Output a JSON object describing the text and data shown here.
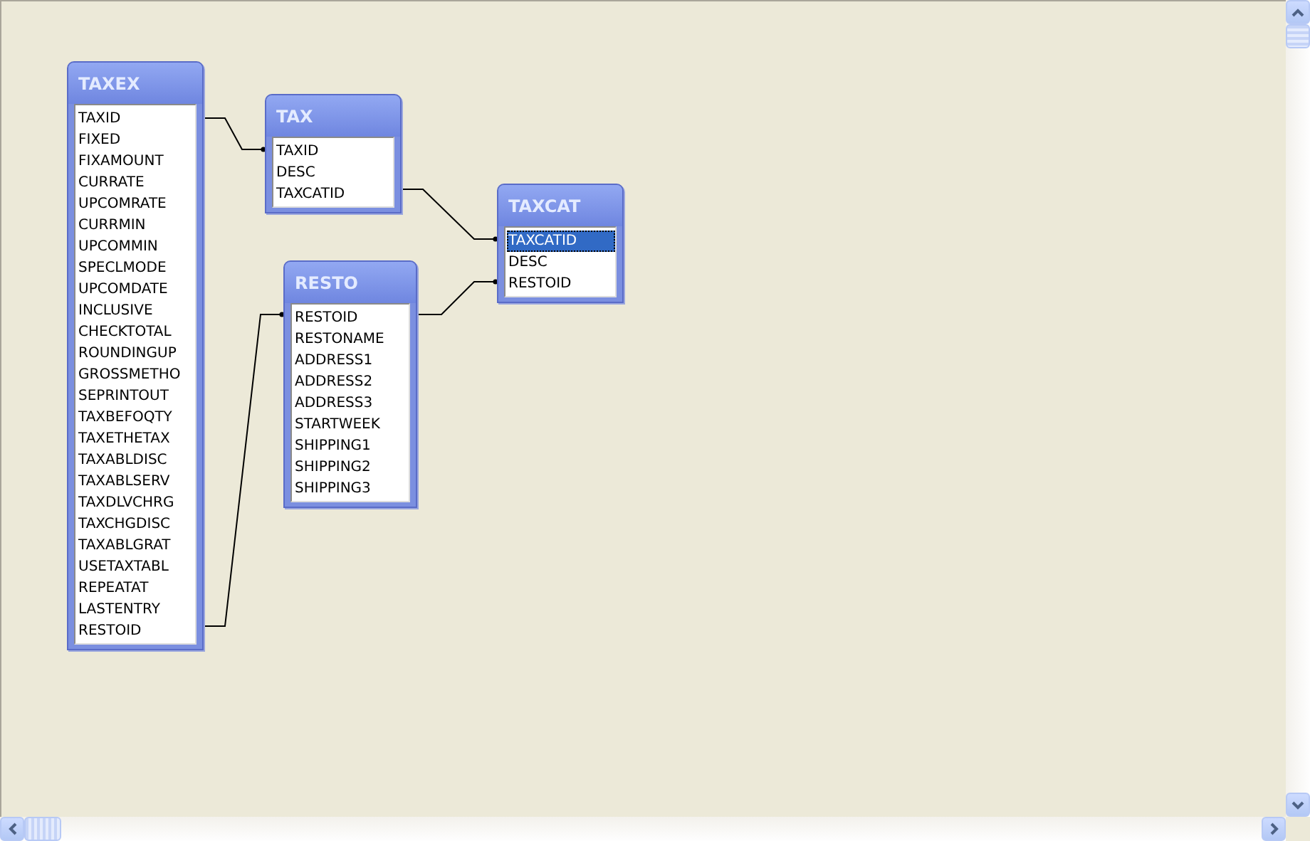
{
  "tables": [
    {
      "name": "TAXEX",
      "fields": [
        {
          "name": "TAXID",
          "selected": false
        },
        {
          "name": "FIXED",
          "selected": false
        },
        {
          "name": "FIXAMOUNT",
          "selected": false
        },
        {
          "name": "CURRATE",
          "selected": false
        },
        {
          "name": "UPCOMRATE",
          "selected": false
        },
        {
          "name": "CURRMIN",
          "selected": false
        },
        {
          "name": "UPCOMMIN",
          "selected": false
        },
        {
          "name": "SPECLMODE",
          "selected": false
        },
        {
          "name": "UPCOMDATE",
          "selected": false
        },
        {
          "name": "INCLUSIVE",
          "selected": false
        },
        {
          "name": "CHECKTOTAL",
          "selected": false
        },
        {
          "name": "ROUNDINGUP",
          "selected": false
        },
        {
          "name": "GROSSMETHO",
          "selected": false
        },
        {
          "name": "SEPRINTOUT",
          "selected": false
        },
        {
          "name": "TAXBEFOQTY",
          "selected": false
        },
        {
          "name": "TAXETHETAX",
          "selected": false
        },
        {
          "name": "TAXABLDISC",
          "selected": false
        },
        {
          "name": "TAXABLSERV",
          "selected": false
        },
        {
          "name": "TAXDLVCHRG",
          "selected": false
        },
        {
          "name": "TAXCHGDISC",
          "selected": false
        },
        {
          "name": "TAXABLGRAT",
          "selected": false
        },
        {
          "name": "USETAXTABL",
          "selected": false
        },
        {
          "name": "REPEATAT",
          "selected": false
        },
        {
          "name": "LASTENTRY",
          "selected": false
        },
        {
          "name": "RESTOID",
          "selected": false
        }
      ]
    },
    {
      "name": "TAX",
      "fields": [
        {
          "name": "TAXID",
          "selected": false
        },
        {
          "name": "DESC",
          "selected": false
        },
        {
          "name": "TAXCATID",
          "selected": false
        }
      ]
    },
    {
      "name": "TAXCAT",
      "fields": [
        {
          "name": "TAXCATID",
          "selected": true
        },
        {
          "name": "DESC",
          "selected": false
        },
        {
          "name": "RESTOID",
          "selected": false
        }
      ]
    },
    {
      "name": "RESTO",
      "fields": [
        {
          "name": "RESTOID",
          "selected": false
        },
        {
          "name": "RESTONAME",
          "selected": false
        },
        {
          "name": "ADDRESS1",
          "selected": false
        },
        {
          "name": "ADDRESS2",
          "selected": false
        },
        {
          "name": "ADDRESS3",
          "selected": false
        },
        {
          "name": "STARTWEEK",
          "selected": false
        },
        {
          "name": "SHIPPING1",
          "selected": false
        },
        {
          "name": "SHIPPING2",
          "selected": false
        },
        {
          "name": "SHIPPING3",
          "selected": false
        }
      ]
    }
  ]
}
